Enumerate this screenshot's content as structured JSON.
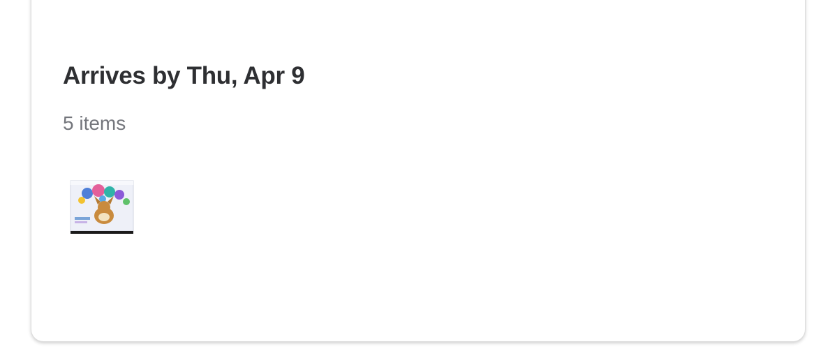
{
  "shipment": {
    "title": "Arrives by Thu, Apr 9",
    "item_count": "5 items"
  },
  "items": [
    {
      "icon": "product-thumbnail",
      "colors": {
        "box": "#eef0f8",
        "character": "#c98b3e",
        "base": "#1b1b1b"
      }
    }
  ]
}
